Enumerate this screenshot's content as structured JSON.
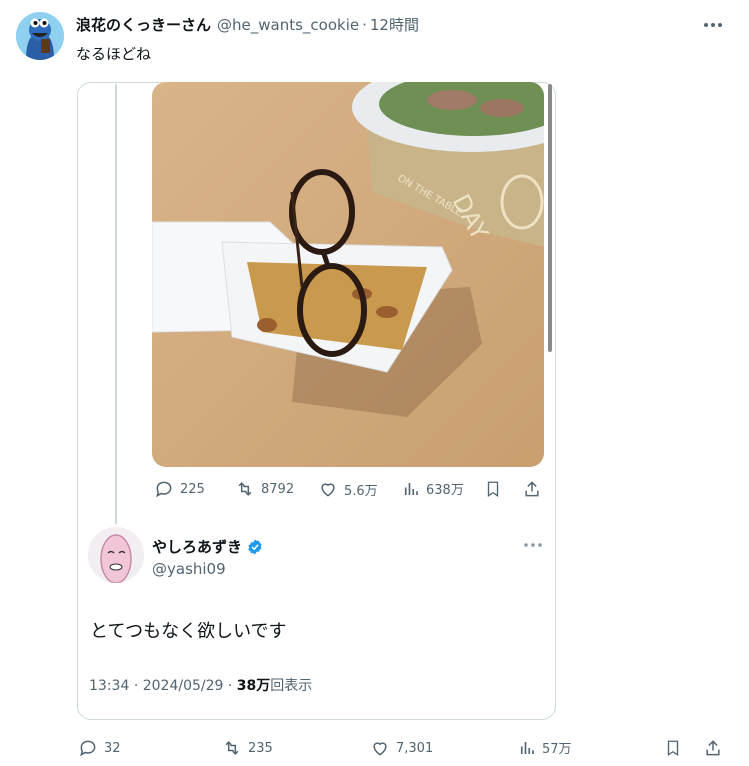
{
  "tweet": {
    "display_name": "浪花のくっきーさん",
    "handle": "@he_wants_cookie",
    "separator": "·",
    "time": "12時間",
    "text": "なるほどね"
  },
  "quoted": {
    "actions": {
      "replies": "225",
      "retweets": "8792",
      "likes": "5.6万",
      "views": "638万"
    },
    "author": {
      "display_name": "やしろあずき",
      "handle": "@yashi09"
    },
    "text": "とてつもなく欲しいです",
    "time": "13:34",
    "separator": "·",
    "date": "2024/05/29",
    "separator2": "·",
    "view_count": "38万",
    "view_label": "回表示"
  },
  "actions": {
    "replies": "32",
    "retweets": "235",
    "likes": "7,301",
    "views": "57万"
  },
  "colors": {
    "muted": "#536471",
    "verified": "#1d9bf0",
    "border": "#cfd9de"
  }
}
